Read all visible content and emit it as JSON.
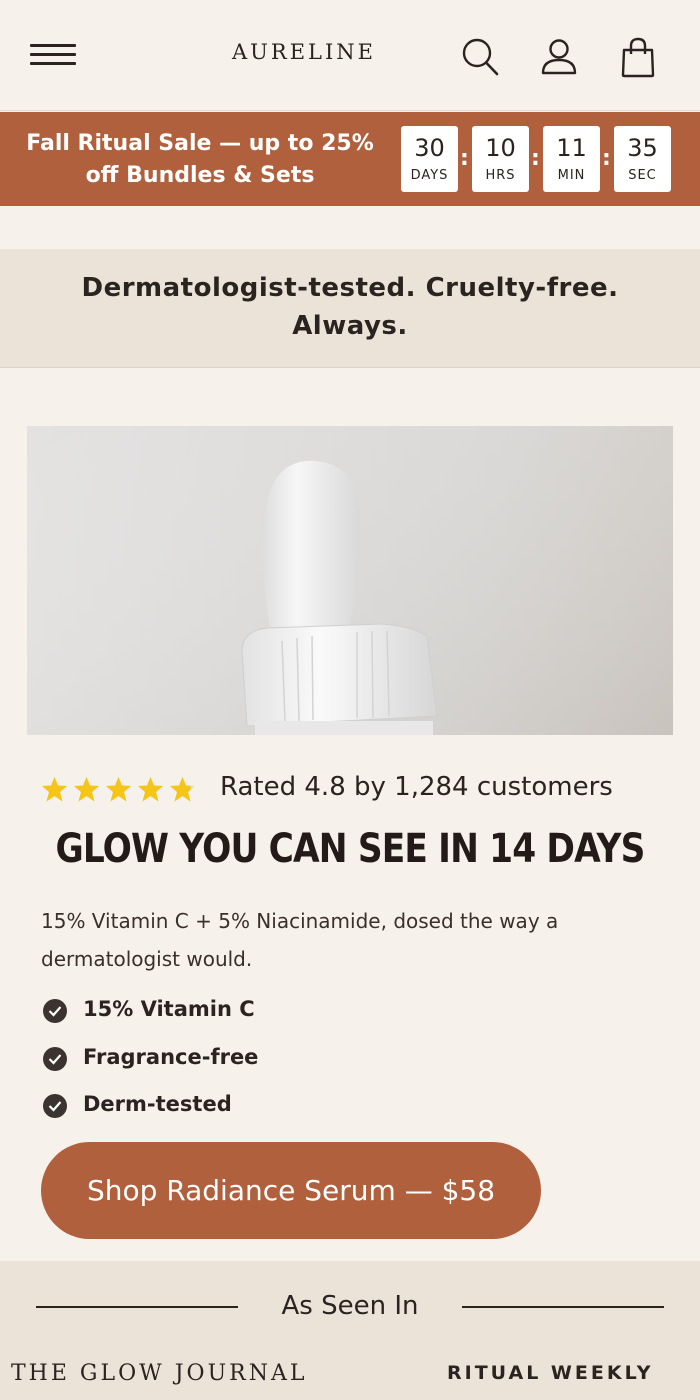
{
  "header": {
    "logo": "AURELINE",
    "icons": [
      "menu-icon",
      "search-icon",
      "account-icon",
      "bag-icon"
    ]
  },
  "sale": {
    "text": "Fall Ritual Sale — up to 25% off Bundles & Sets",
    "countdown": [
      {
        "value": "30",
        "unit": "DAYS"
      },
      {
        "value": "10",
        "unit": "HRS"
      },
      {
        "value": "11",
        "unit": "MIN"
      },
      {
        "value": "35",
        "unit": "SEC"
      }
    ],
    "separator": ":"
  },
  "trust": {
    "text": "Dermatologist-tested. Cruelty-free. Always."
  },
  "product": {
    "rating_value": 4.8,
    "rating_max": 5,
    "rating_text": "Rated 4.8 by 1,284 customers",
    "headline": "GLOW YOU CAN SEE IN 14 DAYS",
    "description": "15% Vitamin C + 5% Niacinamide, dosed the way a dermatologist would.",
    "features": [
      "15% Vitamin C",
      "Fragrance-free",
      "Derm-tested"
    ],
    "cta": "Shop Radiance Serum — $58"
  },
  "press": {
    "title": "As Seen In",
    "logos": [
      "THE GLOW JOURNAL",
      "RITUAL WEEKLY"
    ]
  },
  "colors": {
    "accent": "#b0603c",
    "background": "#f6f1ea",
    "band": "#ece3d8",
    "star": "#f5c518",
    "text": "#2b2320"
  }
}
